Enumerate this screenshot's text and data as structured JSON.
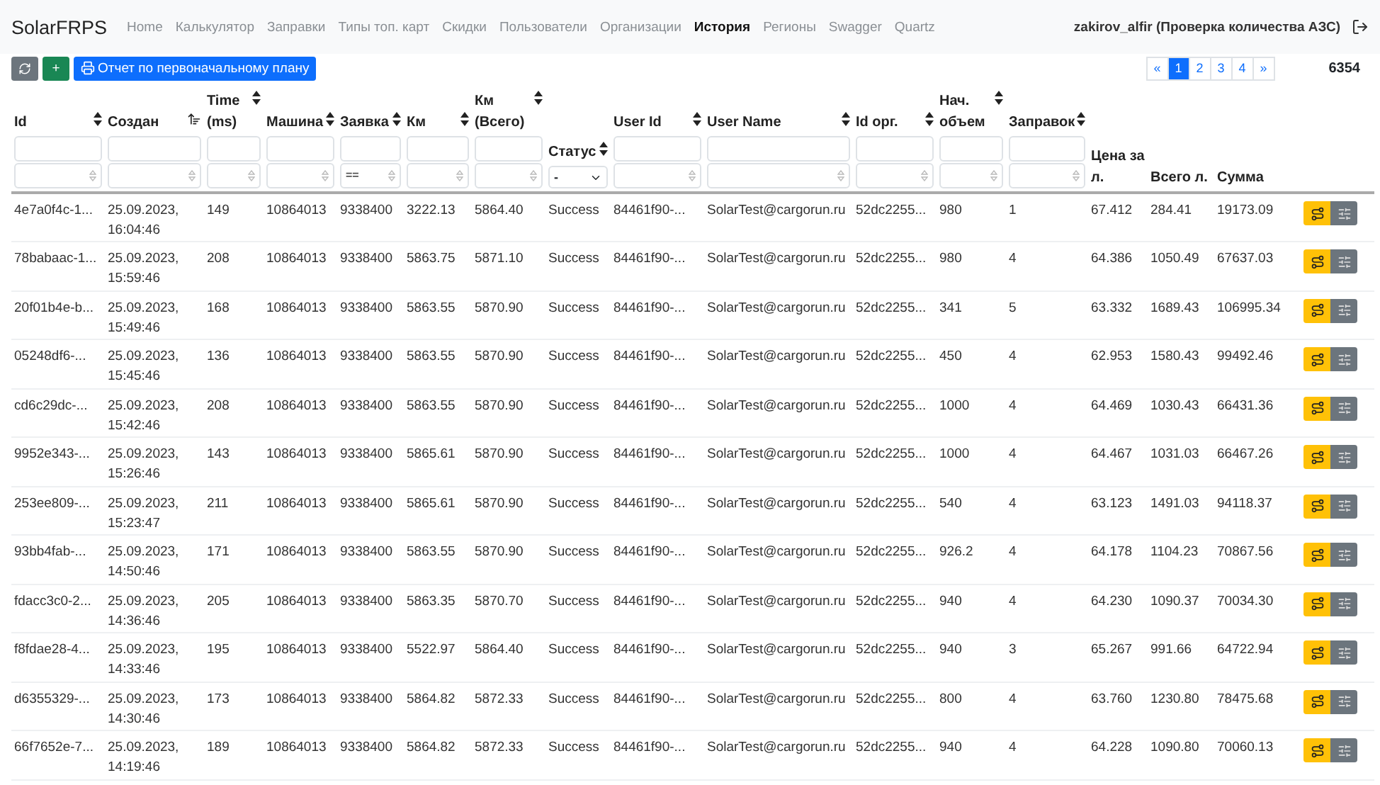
{
  "navbar": {
    "brand": "SolarFRPS",
    "links": [
      {
        "label": "Home",
        "selected": false
      },
      {
        "label": "Калькулятор",
        "selected": false
      },
      {
        "label": "Заправки",
        "selected": false
      },
      {
        "label": "Типы топ. карт",
        "selected": false
      },
      {
        "label": "Скидки",
        "selected": false
      },
      {
        "label": "Пользователи",
        "selected": false
      },
      {
        "label": "Организации",
        "selected": false
      },
      {
        "label": "История",
        "selected": true
      },
      {
        "label": "Регионы",
        "selected": false
      },
      {
        "label": "Swagger",
        "selected": false
      },
      {
        "label": "Quartz",
        "selected": false
      }
    ],
    "user": "zakirov_alfir (Проверка количества АЗС)"
  },
  "toolbar": {
    "buttons": [
      {
        "kind": "refresh"
      },
      {
        "kind": "add",
        "label": "+"
      },
      {
        "kind": "print",
        "label": "Отчет по первоначальному плану"
      }
    ]
  },
  "pagination": {
    "prev": "«",
    "pages": [
      {
        "label": "1",
        "selected": true
      },
      {
        "label": "2",
        "selected": false
      },
      {
        "label": "3",
        "selected": false
      },
      {
        "label": "4",
        "selected": false
      }
    ],
    "next": "»"
  },
  "total": "6354",
  "table": {
    "columns": [
      {
        "label": "Id",
        "sortable": true,
        "sorted_ascending": false,
        "kind": "fields"
      },
      {
        "label": "Создан",
        "sortable": true,
        "sorted_ascending": true,
        "kind": "fields"
      },
      {
        "label": "Time (ms)",
        "sortable": true,
        "sorted_ascending": false,
        "kind": "fields"
      },
      {
        "label": "Машина",
        "sortable": true,
        "sorted_ascending": false,
        "kind": "fields"
      },
      {
        "label": "Заявка",
        "sortable": true,
        "sorted_ascending": false,
        "kind": "fields",
        "operator": "=="
      },
      {
        "label": "Км",
        "sortable": true,
        "sorted_ascending": false,
        "kind": "fields"
      },
      {
        "label": "Км (Всего)",
        "sortable": true,
        "sorted_ascending": false,
        "kind": "fields"
      },
      {
        "label": "Статус",
        "sortable": true,
        "sorted_ascending": false,
        "kind": "select",
        "value": "-"
      },
      {
        "label": "User Id",
        "sortable": true,
        "sorted_ascending": false,
        "kind": "fields"
      },
      {
        "label": "User Name",
        "sortable": true,
        "sorted_ascending": false,
        "kind": "fields"
      },
      {
        "label": "Id орг.",
        "sortable": true,
        "sorted_ascending": false,
        "kind": "fields"
      },
      {
        "label": "Нач. объем",
        "sortable": true,
        "sorted_ascending": false,
        "kind": "fields"
      },
      {
        "label": "Заправок",
        "sortable": true,
        "sorted_ascending": false,
        "kind": "fields"
      },
      {
        "label": "Цена за л.",
        "sortable": false,
        "sorted_ascending": false,
        "kind": "plain"
      },
      {
        "label": "Всего л.",
        "sortable": false,
        "sorted_ascending": false,
        "kind": "plain"
      },
      {
        "label": "Сумма",
        "sortable": false,
        "sorted_ascending": false,
        "kind": "plain"
      }
    ],
    "rows": [
      [
        "4e7a0f4c-1...",
        "25.09.2023, 16:04:46",
        "149",
        "10864013",
        "9338400",
        "3222.13",
        "5864.40",
        "Success",
        "84461f90-...",
        "SolarTest@cargorun.ru",
        "52dc2255...",
        "980",
        "1",
        "67.412",
        "284.41",
        "19173.09"
      ],
      [
        "78babaac-1...",
        "25.09.2023, 15:59:46",
        "208",
        "10864013",
        "9338400",
        "5863.75",
        "5871.10",
        "Success",
        "84461f90-...",
        "SolarTest@cargorun.ru",
        "52dc2255...",
        "980",
        "4",
        "64.386",
        "1050.49",
        "67637.03"
      ],
      [
        "20f01b4e-b...",
        "25.09.2023, 15:49:46",
        "168",
        "10864013",
        "9338400",
        "5863.55",
        "5870.90",
        "Success",
        "84461f90-...",
        "SolarTest@cargorun.ru",
        "52dc2255...",
        "341",
        "5",
        "63.332",
        "1689.43",
        "106995.34"
      ],
      [
        "05248df6-...",
        "25.09.2023, 15:45:46",
        "136",
        "10864013",
        "9338400",
        "5863.55",
        "5870.90",
        "Success",
        "84461f90-...",
        "SolarTest@cargorun.ru",
        "52dc2255...",
        "450",
        "4",
        "62.953",
        "1580.43",
        "99492.46"
      ],
      [
        "cd6c29dc-...",
        "25.09.2023, 15:42:46",
        "208",
        "10864013",
        "9338400",
        "5863.55",
        "5870.90",
        "Success",
        "84461f90-...",
        "SolarTest@cargorun.ru",
        "52dc2255...",
        "1000",
        "4",
        "64.469",
        "1030.43",
        "66431.36"
      ],
      [
        "9952e343-...",
        "25.09.2023, 15:26:46",
        "143",
        "10864013",
        "9338400",
        "5865.61",
        "5870.90",
        "Success",
        "84461f90-...",
        "SolarTest@cargorun.ru",
        "52dc2255...",
        "1000",
        "4",
        "64.467",
        "1031.03",
        "66467.26"
      ],
      [
        "253ee809-...",
        "25.09.2023, 15:23:47",
        "211",
        "10864013",
        "9338400",
        "5865.61",
        "5870.90",
        "Success",
        "84461f90-...",
        "SolarTest@cargorun.ru",
        "52dc2255...",
        "540",
        "4",
        "63.123",
        "1491.03",
        "94118.37"
      ],
      [
        "93bb4fab-...",
        "25.09.2023, 14:50:46",
        "171",
        "10864013",
        "9338400",
        "5863.55",
        "5870.90",
        "Success",
        "84461f90-...",
        "SolarTest@cargorun.ru",
        "52dc2255...",
        "926.2",
        "4",
        "64.178",
        "1104.23",
        "70867.56"
      ],
      [
        "fdacc3c0-2...",
        "25.09.2023, 14:36:46",
        "205",
        "10864013",
        "9338400",
        "5863.35",
        "5870.70",
        "Success",
        "84461f90-...",
        "SolarTest@cargorun.ru",
        "52dc2255...",
        "940",
        "4",
        "64.230",
        "1090.37",
        "70034.30"
      ],
      [
        "f8fdae28-4...",
        "25.09.2023, 14:33:46",
        "195",
        "10864013",
        "9338400",
        "5522.97",
        "5864.40",
        "Success",
        "84461f90-...",
        "SolarTest@cargorun.ru",
        "52dc2255...",
        "940",
        "3",
        "65.267",
        "991.66",
        "64722.94"
      ],
      [
        "d6355329-...",
        "25.09.2023, 14:30:46",
        "173",
        "10864013",
        "9338400",
        "5864.82",
        "5872.33",
        "Success",
        "84461f90-...",
        "SolarTest@cargorun.ru",
        "52dc2255...",
        "800",
        "4",
        "63.760",
        "1230.80",
        "78475.68"
      ],
      [
        "66f7652e-7...",
        "25.09.2023, 14:19:46",
        "189",
        "10864013",
        "9338400",
        "5864.82",
        "5872.33",
        "Success",
        "84461f90-...",
        "SolarTest@cargorun.ru",
        "52dc2255...",
        "940",
        "4",
        "64.228",
        "1090.80",
        "70060.13"
      ]
    ]
  }
}
